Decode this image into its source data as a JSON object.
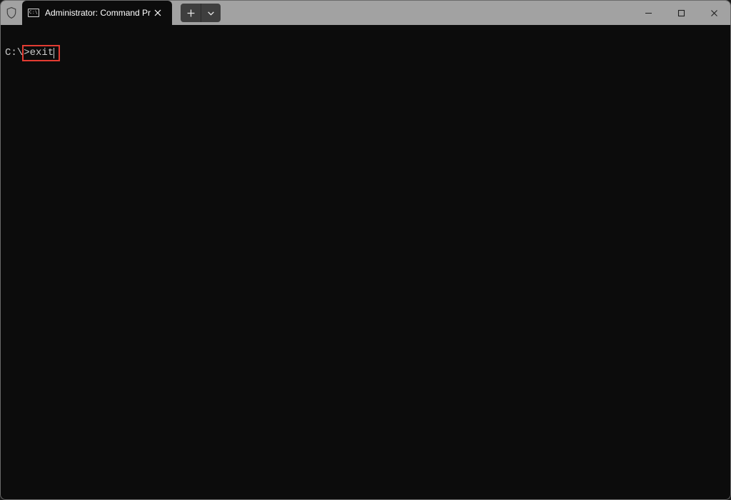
{
  "window": {
    "tab_title": "Administrator: Command Pro",
    "app_icon_text": "C:\\"
  },
  "terminal": {
    "prompt_prefix": "C:\\",
    "prompt_command": ">exit"
  }
}
